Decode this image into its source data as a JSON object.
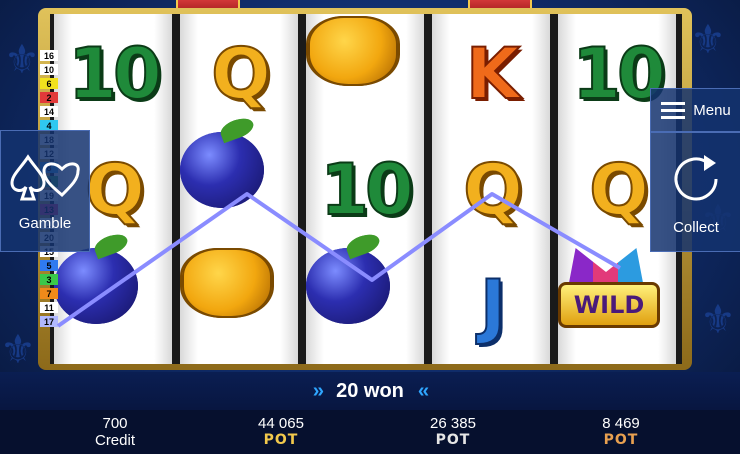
{
  "reels": [
    [
      {
        "kind": "ten",
        "label": "10"
      },
      {
        "kind": "q",
        "label": "Q"
      },
      {
        "kind": "plum",
        "label": ""
      }
    ],
    [
      {
        "kind": "q",
        "label": "Q"
      },
      {
        "kind": "plum",
        "label": ""
      },
      {
        "kind": "pot",
        "label": ""
      }
    ],
    [
      {
        "kind": "pot",
        "label": ""
      },
      {
        "kind": "ten",
        "label": "10"
      },
      {
        "kind": "plum",
        "label": ""
      }
    ],
    [
      {
        "kind": "k",
        "label": "K"
      },
      {
        "kind": "q",
        "label": "Q"
      },
      {
        "kind": "j",
        "label": "J"
      }
    ],
    [
      {
        "kind": "ten",
        "label": "10"
      },
      {
        "kind": "q",
        "label": "Q"
      },
      {
        "kind": "wild",
        "label": "WILD"
      }
    ]
  ],
  "paylines": [
    {
      "label": "16",
      "color": "#ffffff"
    },
    {
      "label": "10",
      "color": "#ffffff"
    },
    {
      "label": "6",
      "color": "#f2e21e"
    },
    {
      "label": "2",
      "color": "#e23a3a"
    },
    {
      "label": "14",
      "color": "#ffffff"
    },
    {
      "label": "4",
      "color": "#2fc8f0"
    },
    {
      "label": "18",
      "color": "#ffffff"
    },
    {
      "label": "12",
      "color": "#ffffff"
    },
    {
      "label": "8",
      "color": "#3aa0e0"
    },
    {
      "label": "9",
      "color": "#3aa050"
    },
    {
      "label": "19",
      "color": "#ffffff"
    },
    {
      "label": "13",
      "color": "#e23a7a"
    },
    {
      "label": "1",
      "color": "#ffffff"
    },
    {
      "label": "20",
      "color": "#ffffff"
    },
    {
      "label": "15",
      "color": "#ffffff"
    },
    {
      "label": "5",
      "color": "#2f7af0"
    },
    {
      "label": "3",
      "color": "#3ac84a"
    },
    {
      "label": "7",
      "color": "#ef8a1a"
    },
    {
      "label": "11",
      "color": "#ffffff"
    },
    {
      "label": "17",
      "color": "#b0b8ff"
    }
  ],
  "gamble": {
    "label": "Gamble",
    "icon": "spade-heart-icon"
  },
  "menu": {
    "label": "Menu",
    "icon": "hamburger-icon"
  },
  "collect": {
    "label": "Collect",
    "icon": "refresh-icon"
  },
  "win_text": "20 won",
  "credit": {
    "value": "700",
    "label": "Credit"
  },
  "pots": [
    {
      "value": "44 065",
      "label": "POT",
      "color": "#f2c94c"
    },
    {
      "value": "26 385",
      "label": "POT",
      "color": "#e6e6e6"
    },
    {
      "value": "8 469",
      "label": "POT",
      "color": "#e8a050"
    }
  ],
  "colors": {
    "winline": "#8a8cff"
  }
}
